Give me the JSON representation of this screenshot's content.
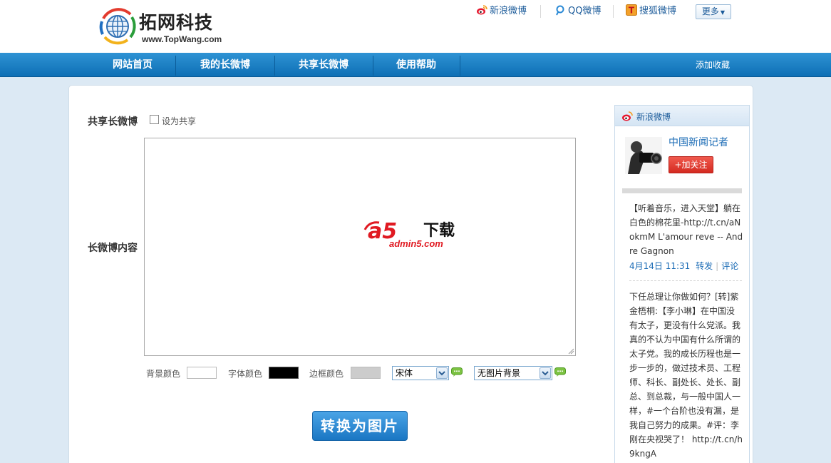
{
  "brand": {
    "name": "拓网科技",
    "url": "www.TopWang.com"
  },
  "toplinks": [
    {
      "label": "新浪微博",
      "icon": "sina-weibo-icon"
    },
    {
      "label": "QQ微博",
      "icon": "qq-weibo-icon"
    },
    {
      "label": "搜狐微博",
      "icon": "sohu-weibo-icon"
    }
  ],
  "more_label": "更多",
  "nav": {
    "items": [
      "网站首页",
      "我的长微博",
      "共享长微博",
      "使用帮助"
    ],
    "favorite": "添加收藏"
  },
  "form": {
    "share_label": "共享长微博",
    "share_checkbox_label": "设为共享",
    "share_checked": false,
    "content_label": "长微博内容",
    "watermark": {
      "logo_text": "a5",
      "cn_text": "下载",
      "site": "admin5.com"
    },
    "options": {
      "bg_color_label": "背景颜色",
      "bg_color": "#ffffff",
      "font_color_label": "字体颜色",
      "font_color": "#000000",
      "border_color_label": "边框颜色",
      "border_color": "#cccccc",
      "font_select": "宋体",
      "bg_image_select": "无图片背景"
    },
    "convert_button": "转换为图片"
  },
  "sidebar": {
    "title": "新浪微博",
    "user_name": "中国新闻记者",
    "follow_label": "+加关注",
    "posts": [
      {
        "text": "【听着音乐，进入天堂】躺在白色的棉花里-http://t.cn/aNokmM L'amour reve -- Andre Gagnon",
        "time": "4月14日 11:31",
        "repost": "转发",
        "comment": "评论"
      },
      {
        "text": "下任总理让你做如何？[转]紫金梧桐:【李小琳】在中国没有太子，更没有什么党派。我真的不认为中国有什么所谓的太子党。我的成长历程也是一步一步的，做过技术员、工程师、科长、副处长、处长、副总、到总裁，与一般中国人一样，#一个台阶也没有漏，是我自己努力的成果。#评：李刚在央视哭了！ http://t.cn/h9kngA"
      }
    ]
  },
  "colors": {
    "nav_blue": "#1a7fc6",
    "link_blue": "#1a6bb5",
    "follow_red": "#e0382d",
    "page_bg": "#dce9f4"
  }
}
